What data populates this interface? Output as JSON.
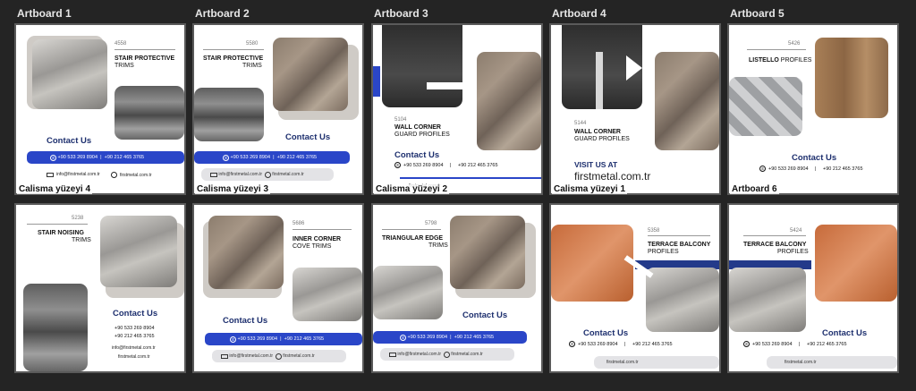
{
  "artboard_labels": [
    "Artboard 1",
    "Artboard 2",
    "Artboard 3",
    "Artboard 4",
    "Artboard 5"
  ],
  "overlay_labels": [
    "Calisma yüzeyi 4",
    "Calisma yüzeyi 3",
    "Calisma yüzeyi 2",
    "Calisma yüzeyi 1",
    "Artboard 6"
  ],
  "contact": {
    "title": "Contact Us",
    "phone1": "+90 533 269 8904",
    "phone2": "+90 212 465 3765",
    "separator": "|",
    "email": "info@firstmetal.com.tr",
    "web": "firstmetal.com.tr"
  },
  "boards": {
    "a1": {
      "number": "4558",
      "title_bold": "STAIR PROTECTIVE",
      "title_light": "TRIMS"
    },
    "a2": {
      "number": "5580",
      "title_bold": "STAIR PROTECTIVE",
      "title_light": "TRIMS"
    },
    "a3": {
      "number": "5104",
      "title_bold": "WALL CORNER",
      "title_light": "GUARD PROFILES"
    },
    "a4": {
      "number": "5144",
      "title_bold": "WALL CORNER",
      "title_light": "GUARD PROFILES",
      "visit": "VISIT US AT",
      "site": "firstmetal.com.tr"
    },
    "a5": {
      "number": "5426",
      "title_bold": "LISTELLO",
      "title_light": "PROFILES"
    },
    "b1": {
      "number": "5238",
      "title_bold": "STAIR NOISING",
      "title_light": "TRIMS"
    },
    "b2": {
      "number": "5686",
      "title_bold": "INNER CORNER",
      "title_light": "COVE TRIMS"
    },
    "b3": {
      "number": "5798",
      "title_bold": "TRIANGULAR EDGE",
      "title_light": "TRIMS"
    },
    "b4": {
      "number": "5358",
      "title_bold": "TERRACE BALCONY",
      "title_light": "PROFILES"
    },
    "b5": {
      "number": "5424",
      "title_bold": "TERRACE BALCONY",
      "title_light": "PROFILES"
    }
  },
  "colors": {
    "background": "#242424",
    "brand_blue": "#2a46c8",
    "contact_text": "#1d2f6e"
  }
}
